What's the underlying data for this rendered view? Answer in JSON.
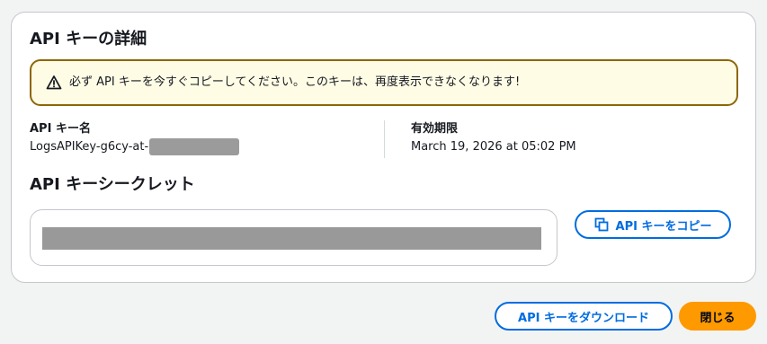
{
  "dialog": {
    "title": "API キーの詳細",
    "warning": "必ず API キーを今すぐコピーしてください。このキーは、再度表示できなくなります!",
    "key_name_label": "API キー名",
    "key_name_value": "LogsAPIKey-g6cy-at-",
    "expiry_label": "有効期限",
    "expiry_value": "March 19, 2026 at 05:02 PM",
    "secret_title": "API キーシークレット",
    "copy_button": "API キーをコピー",
    "download_button": "API キーをダウンロード",
    "close_button": "閉じる"
  },
  "colors": {
    "accent": "#006ce0",
    "primary_button": "#ff9900",
    "warning_border": "#8d6605",
    "warning_bg": "#fffce6"
  }
}
